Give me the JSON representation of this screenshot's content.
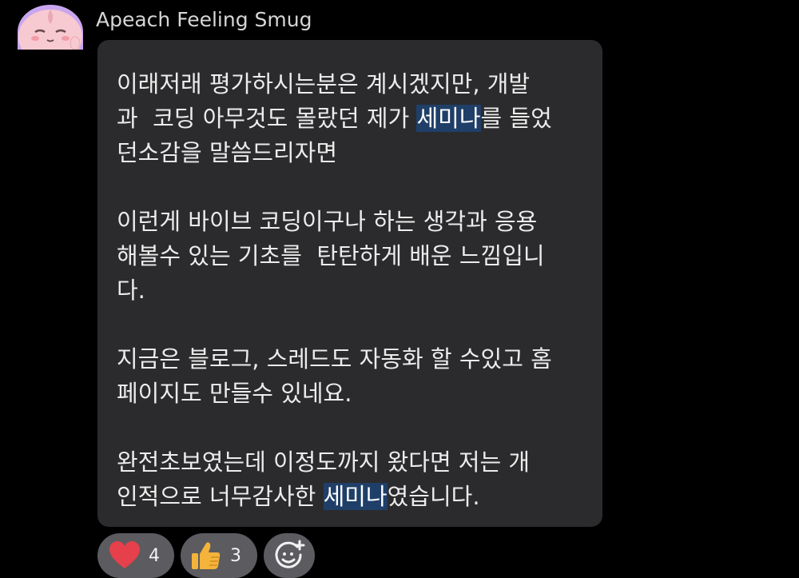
{
  "sender": {
    "name": "Apeach Feeling Smug",
    "avatar_icon": "apeach-smug-icon",
    "avatar_color": "#c9a6f0"
  },
  "message": {
    "segments": [
      "이래저래 평가하시는분은 계시겠지만, 개발\n과  코딩 아무것도 몰랐던 제가 ",
      "세미나",
      "를 들었\n던소감을 말씀드리자면\n\n이런게 바이브 코딩이구나 하는 생각과 응용\n해볼수 있는 기초를  탄탄하게 배운 느낌입니\n다.\n\n지금은 블로그, 스레드도 자동화 할 수있고 홈\n페이지도 만들수 있네요.\n\n완전초보였는데 이정도까지 왔다면 저는 개\n인적으로 너무감사한 ",
      "세미나",
      "였습니다."
    ],
    "highlight_color": "#1f3f68",
    "bubble_color": "#2b2b2d"
  },
  "reactions": {
    "heart": {
      "icon": "heart-icon",
      "count": "4",
      "color": "#e5404b"
    },
    "thumbs_up": {
      "icon": "thumbs-up-icon",
      "count": "3",
      "color": "#f4b33a"
    },
    "add": {
      "icon": "add-reaction-icon"
    }
  }
}
